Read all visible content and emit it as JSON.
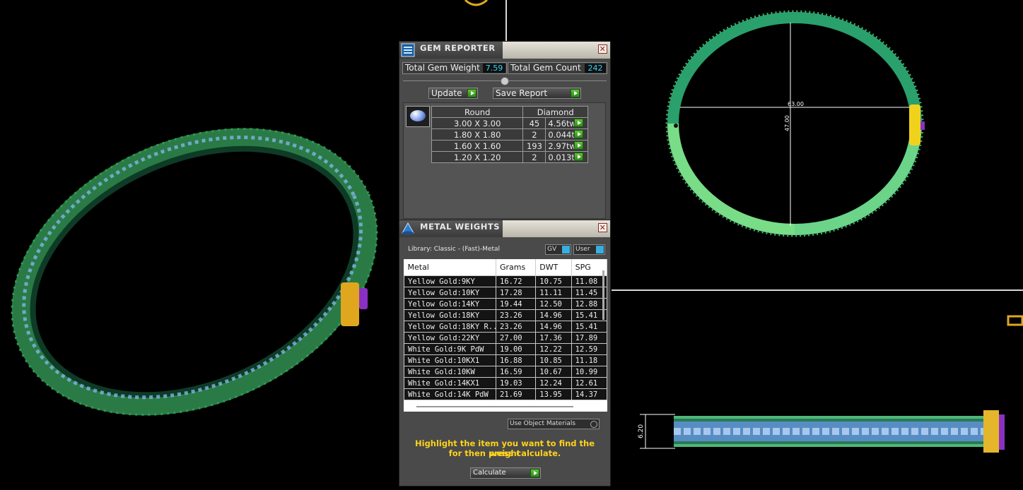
{
  "gem_reporter": {
    "title": "GEM REPORTER",
    "close": "✕",
    "total_gem_weight_label": "Total Gem Weight",
    "total_gem_weight": "7.59",
    "total_gem_count_label": "Total Gem Count",
    "total_gem_count": "242",
    "update_label": "Update",
    "save_report_label": "Save Report",
    "table": {
      "col_shape": "Round",
      "col_type": "Diamond",
      "rows": [
        {
          "size": "3.00 X 3.00",
          "count": "45",
          "weight": "4.56tw"
        },
        {
          "size": "1.80 X 1.80",
          "count": "2",
          "weight": "0.044tw"
        },
        {
          "size": "1.60 X 1.60",
          "count": "193",
          "weight": "2.97tw"
        },
        {
          "size": "1.20 X 1.20",
          "count": "2",
          "weight": "0.013tw"
        }
      ]
    }
  },
  "metal_weights": {
    "title": "METAL WEIGHTS",
    "close": "✕",
    "library": "Library: Classic - (Fast)-Metal",
    "gv_label": "GV",
    "user_label": "User",
    "columns": [
      "Metal",
      "Grams",
      "DWT",
      "SPG"
    ],
    "rows": [
      [
        "Yellow Gold:9KY",
        "16.72",
        "10.75",
        "11.08"
      ],
      [
        "Yellow Gold:10KY",
        "17.28",
        "11.11",
        "11.45"
      ],
      [
        "Yellow Gold:14KY",
        "19.44",
        "12.50",
        "12.88"
      ],
      [
        "Yellow Gold:18KY",
        "23.26",
        "14.96",
        "15.41"
      ],
      [
        "Yellow Gold:18KY R...",
        "23.26",
        "14.96",
        "15.41"
      ],
      [
        "Yellow Gold:22KY",
        "27.00",
        "17.36",
        "17.89"
      ],
      [
        "White Gold:9K PdW",
        "19.00",
        "12.22",
        "12.59"
      ],
      [
        "White Gold:10KX1",
        "16.88",
        "10.85",
        "11.18"
      ],
      [
        "White Gold:10KW",
        "16.59",
        "10.67",
        "10.99"
      ],
      [
        "White Gold:14KX1",
        "19.03",
        "12.24",
        "12.61"
      ],
      [
        "White Gold:14K PdW",
        "21.69",
        "13.95",
        "14.37"
      ]
    ],
    "use_object_materials": "Use Object Materials",
    "hint_line1": "Highlight the item you want to find the weight",
    "hint_line2": "for then press calculate.",
    "calculate_label": "Calculate"
  },
  "viewport": {
    "dim_width": "63.00",
    "dim_height": "47.00",
    "dim_side": "6.20"
  },
  "colors": {
    "band_dark_green": "#1e6a43",
    "band_light_green": "#7ee08d",
    "accent_cyan": "#34d4ff",
    "hint_yellow": "#ffd21a"
  }
}
